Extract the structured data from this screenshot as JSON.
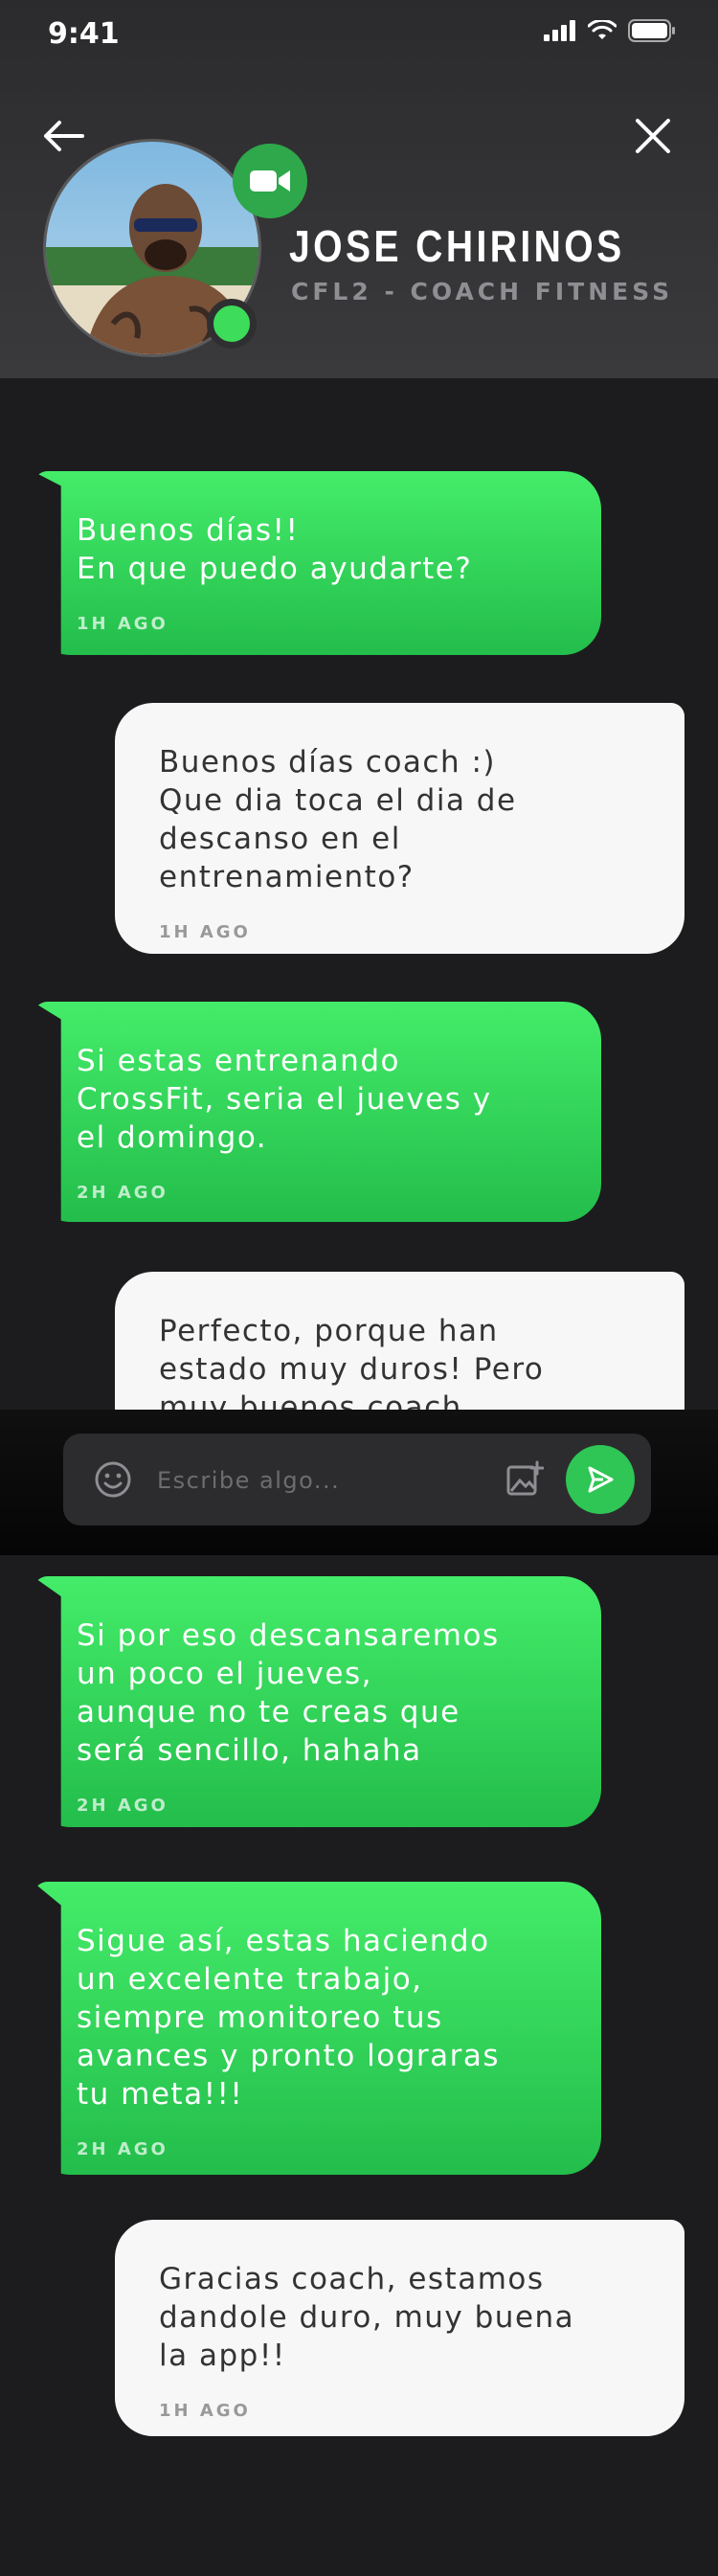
{
  "status_bar": {
    "time": "9:41"
  },
  "header": {
    "name": "JOSE CHIRINOS",
    "role": "CFL2 - COACH FITNESS"
  },
  "messages": [
    {
      "from": "coach",
      "text": "Buenos días!!\nEn que puedo ayudarte?",
      "time": "1H AGO"
    },
    {
      "from": "user",
      "text": "Buenos días coach :)\nQue dia toca el dia de\ndescanso en el\nentrenamiento?",
      "time": "1H AGO"
    },
    {
      "from": "coach",
      "text": "Si estas entrenando\nCrossFit, seria el jueves y\nel domingo.",
      "time": "2H AGO"
    },
    {
      "from": "user",
      "text": "Perfecto, porque han\nestado muy duros! Pero\nmuy buenos coach",
      "time": ""
    },
    {
      "from": "coach",
      "text": "Si por eso descansaremos\nun poco el jueves,\naunque no te creas que\nserá sencillo, hahaha",
      "time": "2H AGO"
    },
    {
      "from": "coach",
      "text": "Sigue así, estas haciendo\nun excelente trabajo,\nsiempre monitoreo tus\navances y pronto lograras\ntu meta!!!",
      "time": "2H AGO"
    },
    {
      "from": "user",
      "text": "Gracias coach, estamos\ndandole duro, muy buena\nla app!!",
      "time": "1H AGO"
    }
  ],
  "composer": {
    "placeholder": "Escribe algo..."
  },
  "colors": {
    "accent": "#2fc655",
    "bubble_in": "#3ddc5a",
    "bubble_out": "#f7f7f7",
    "background": "#1c1c1e"
  },
  "icons": [
    "back-arrow-icon",
    "close-icon",
    "video-camera-icon",
    "emoji-icon",
    "add-image-icon",
    "send-icon"
  ]
}
